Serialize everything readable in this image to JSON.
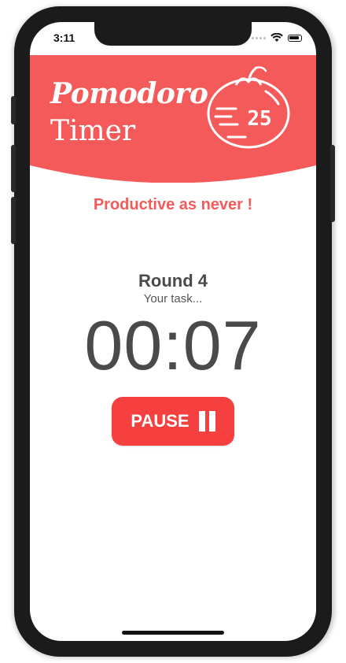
{
  "status_bar": {
    "time": "3:11"
  },
  "header": {
    "title_script": "Pomodoro",
    "title_sub": "Timer",
    "logo_number": "25",
    "background_color": "#f55a5a"
  },
  "tagline": "Productive as never !",
  "session": {
    "round_label": "Round 4",
    "task_text": "Your task...",
    "timer": "00:07"
  },
  "controls": {
    "pause_label": "PAUSE"
  },
  "colors": {
    "accent": "#f55a5a",
    "button": "#f5403f",
    "text_dark": "#4a4a4a"
  }
}
